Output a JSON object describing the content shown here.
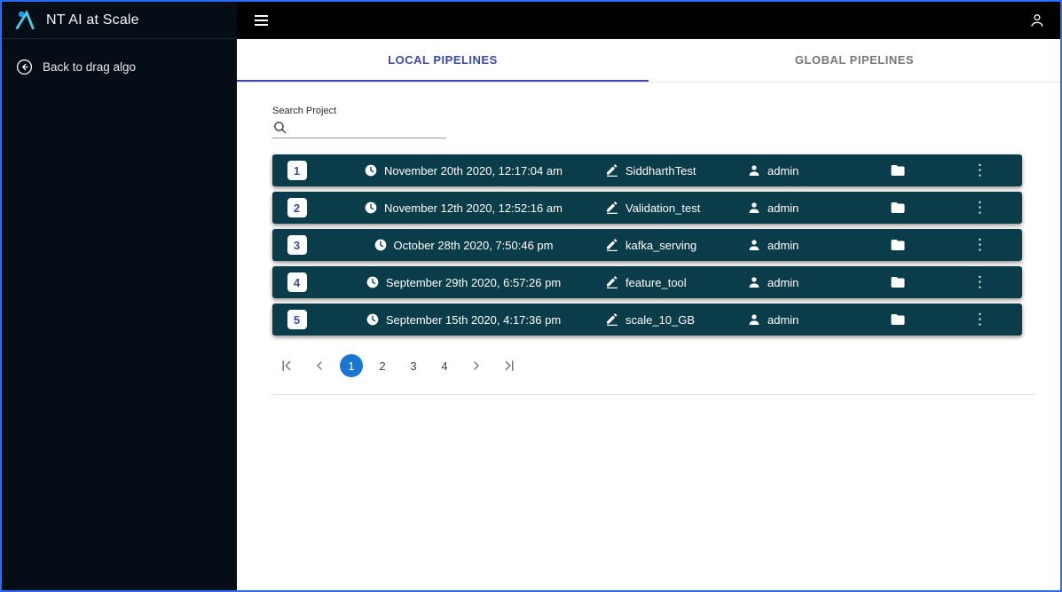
{
  "sidebar": {
    "logo_text": "NT AI at Scale",
    "back_label": "Back to drag algo"
  },
  "tabs": [
    {
      "label": "LOCAL PIPELINES",
      "active": true
    },
    {
      "label": "GLOBAL PIPELINES",
      "active": false
    }
  ],
  "search": {
    "label": "Search Project",
    "value": ""
  },
  "pipelines": [
    {
      "index": "1",
      "date": "November 20th 2020, 12:17:04 am",
      "name": "SiddharthTest",
      "owner": "admin"
    },
    {
      "index": "2",
      "date": "November 12th 2020, 12:52:16 am",
      "name": "Validation_test",
      "owner": "admin"
    },
    {
      "index": "3",
      "date": "October 28th 2020, 7:50:46 pm",
      "name": "kafka_serving",
      "owner": "admin"
    },
    {
      "index": "4",
      "date": "September 29th 2020, 6:57:26 pm",
      "name": "feature_tool",
      "owner": "admin"
    },
    {
      "index": "5",
      "date": "September 15th 2020, 4:17:36 pm",
      "name": "scale_10_GB",
      "owner": "admin"
    }
  ],
  "pagination": {
    "pages": [
      "1",
      "2",
      "3",
      "4"
    ],
    "active_page": "1"
  },
  "icons": {
    "kebab": "⋮"
  },
  "colors": {
    "row_bg": "#0b3c4a",
    "sidebar_bg": "#050e17",
    "accent": "#3949ab",
    "active_page_bg": "#1976d2",
    "screen_border": "#2a6df4"
  }
}
